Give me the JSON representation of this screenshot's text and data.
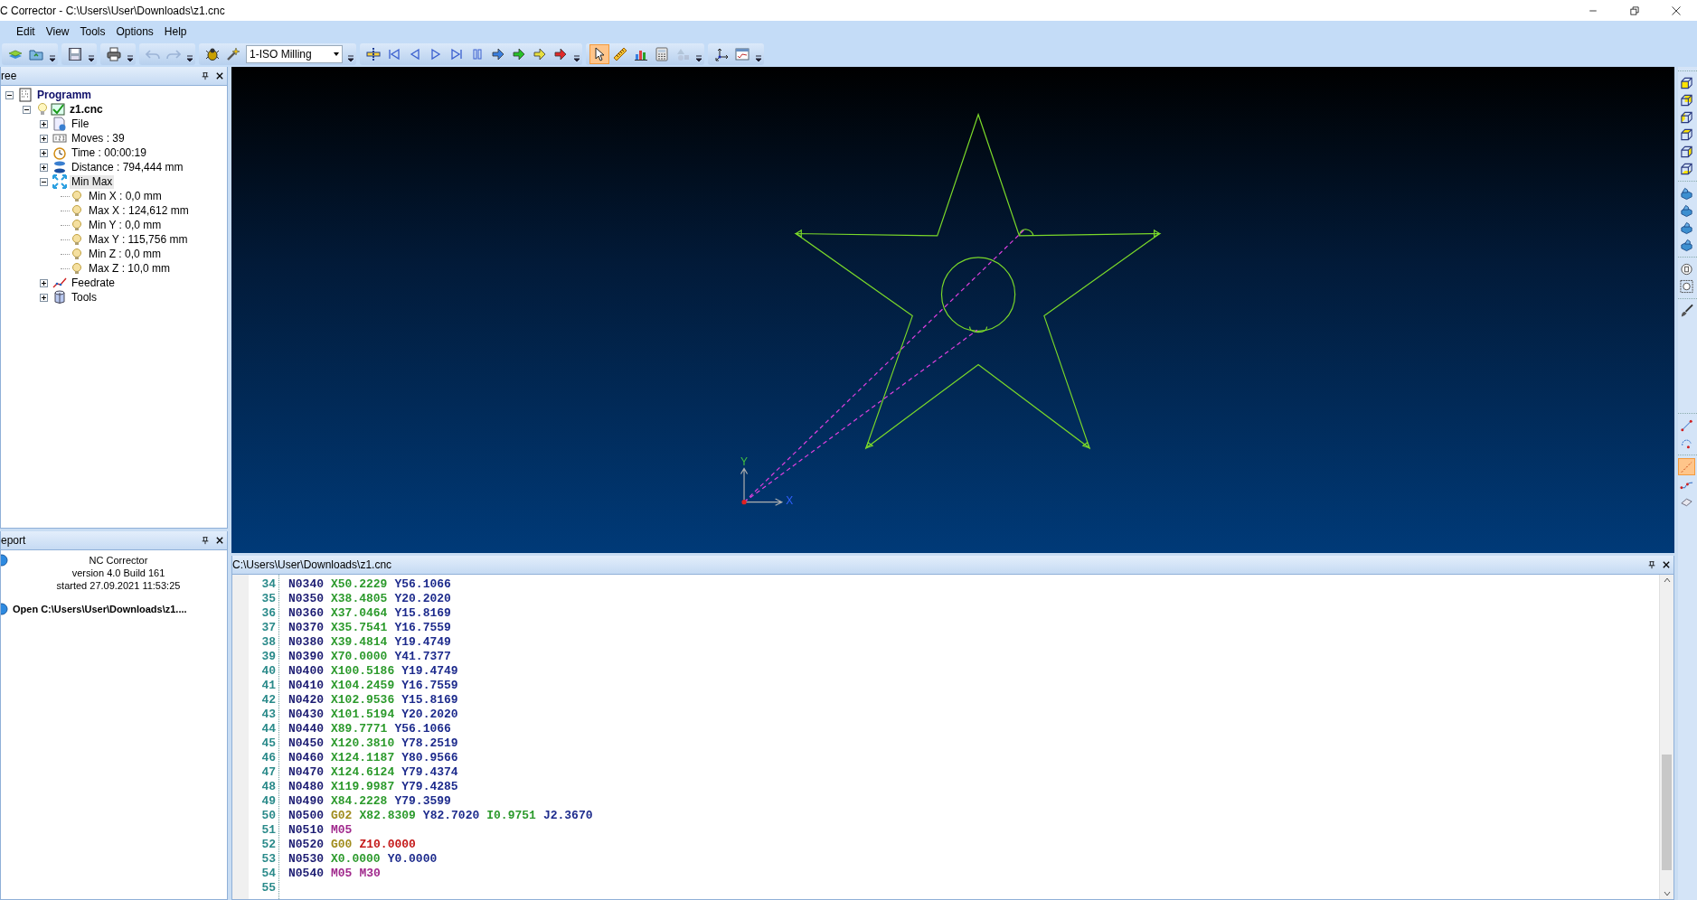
{
  "window": {
    "title": "C Corrector - C:\\Users\\User\\Downloads\\z1.cnc"
  },
  "menu": [
    "Edit",
    "View",
    "Tools",
    "Options",
    "Help"
  ],
  "toolbar": {
    "groups": [
      {
        "items": [
          {
            "kind": "layers",
            "disabled": false,
            "selected": false
          },
          {
            "kind": "open",
            "disabled": false,
            "selected": false
          }
        ]
      },
      {
        "items": [
          {
            "kind": "save",
            "disabled": false,
            "selected": false
          }
        ]
      },
      {
        "items": [
          {
            "kind": "print",
            "disabled": false,
            "selected": false
          }
        ]
      },
      {
        "items": [
          {
            "kind": "undo",
            "disabled": true,
            "selected": false
          },
          {
            "kind": "redo",
            "disabled": true,
            "selected": false
          }
        ]
      },
      {
        "items": [
          {
            "kind": "bug",
            "disabled": false,
            "selected": false
          },
          {
            "kind": "wand",
            "disabled": false,
            "selected": false
          },
          {
            "kind": "select",
            "value": "1-ISO Milling"
          }
        ]
      },
      {
        "items": [
          {
            "kind": "marker",
            "disabled": false,
            "selected": false
          },
          {
            "kind": "first",
            "disabled": false,
            "selected": false
          },
          {
            "kind": "prev",
            "disabled": false,
            "selected": false
          },
          {
            "kind": "next",
            "disabled": false,
            "selected": false
          },
          {
            "kind": "last",
            "disabled": false,
            "selected": false
          },
          {
            "kind": "pause",
            "disabled": false,
            "selected": false
          },
          {
            "kind": "step-blue",
            "disabled": false,
            "selected": false
          },
          {
            "kind": "step-green",
            "disabled": false,
            "selected": false
          },
          {
            "kind": "step-yellow",
            "disabled": false,
            "selected": false
          },
          {
            "kind": "step-red",
            "disabled": false,
            "selected": false
          }
        ]
      },
      {
        "items": [
          {
            "kind": "pointer",
            "disabled": false,
            "selected": true
          },
          {
            "kind": "ruler",
            "disabled": false,
            "selected": false
          },
          {
            "kind": "chart",
            "disabled": false,
            "selected": false
          },
          {
            "kind": "calculator",
            "disabled": false,
            "selected": false
          },
          {
            "kind": "shapes",
            "disabled": true,
            "selected": false
          }
        ]
      },
      {
        "items": [
          {
            "kind": "axes",
            "disabled": false,
            "selected": false
          },
          {
            "kind": "report",
            "disabled": false,
            "selected": false
          }
        ]
      }
    ]
  },
  "tree": {
    "title": "ree",
    "nodes": [
      {
        "label": "Programm",
        "kind": "program",
        "expanded": true,
        "selected": false,
        "children": [
          {
            "label": "z1.cnc",
            "kind": "program-file",
            "expanded": true,
            "selected": false,
            "children": [
              {
                "label": "File",
                "kind": "file-info",
                "expanded": false,
                "selected": false
              },
              {
                "label": "Moves : 39",
                "kind": "counter",
                "expanded": false,
                "selected": false
              },
              {
                "label": "Time : 00:00:19",
                "kind": "clock",
                "expanded": false,
                "selected": false
              },
              {
                "label": "Distance : 794,444 mm",
                "kind": "distance",
                "expanded": false,
                "selected": false
              },
              {
                "label": "Min Max",
                "kind": "minmax",
                "expanded": true,
                "selected": true,
                "children": [
                  {
                    "label": "Min X : 0,0 mm",
                    "kind": "point",
                    "selected": false
                  },
                  {
                    "label": "Max X : 124,612 mm",
                    "kind": "point",
                    "selected": false
                  },
                  {
                    "label": "Min Y : 0,0 mm",
                    "kind": "point",
                    "selected": false
                  },
                  {
                    "label": "Max Y : 115,756 mm",
                    "kind": "point",
                    "selected": false
                  },
                  {
                    "label": "Min Z : 0,0 mm",
                    "kind": "point",
                    "selected": false
                  },
                  {
                    "label": "Max Z : 10,0 mm",
                    "kind": "point",
                    "selected": false
                  }
                ]
              },
              {
                "label": "Feedrate",
                "kind": "feedrate",
                "expanded": false,
                "selected": false
              },
              {
                "label": "Tools",
                "kind": "tools",
                "expanded": false,
                "selected": false
              }
            ]
          }
        ]
      }
    ]
  },
  "report": {
    "title": "eport",
    "entries": [
      {
        "kind": "info",
        "lines": [
          "NC Corrector",
          "version 4.0 Build 161",
          "started 27.09.2021 11:53:25"
        ]
      },
      {
        "kind": "action",
        "lines": [
          "Open C:\\Users\\User\\Downloads\\z1...."
        ]
      }
    ]
  },
  "viewport": {
    "axis_labels": [
      {
        "text": "Y",
        "kind": "y"
      },
      {
        "text": "X",
        "kind": "x"
      }
    ]
  },
  "code": {
    "title": "C:\\Users\\User\\Downloads\\z1.cnc",
    "lines": [
      {
        "number": "34",
        "tokens": [
          {
            "text": "N0340",
            "kind": "n"
          },
          {
            "text": "X50.2229",
            "kind": "x"
          },
          {
            "text": "Y56.1066",
            "kind": "y"
          }
        ]
      },
      {
        "number": "35",
        "tokens": [
          {
            "text": "N0350",
            "kind": "n"
          },
          {
            "text": "X38.4805",
            "kind": "x"
          },
          {
            "text": "Y20.2020",
            "kind": "y"
          }
        ]
      },
      {
        "number": "36",
        "tokens": [
          {
            "text": "N0360",
            "kind": "n"
          },
          {
            "text": "X37.0464",
            "kind": "x"
          },
          {
            "text": "Y15.8169",
            "kind": "y"
          }
        ]
      },
      {
        "number": "37",
        "tokens": [
          {
            "text": "N0370",
            "kind": "n"
          },
          {
            "text": "X35.7541",
            "kind": "x"
          },
          {
            "text": "Y16.7559",
            "kind": "y"
          }
        ]
      },
      {
        "number": "38",
        "tokens": [
          {
            "text": "N0380",
            "kind": "n"
          },
          {
            "text": "X39.4814",
            "kind": "x"
          },
          {
            "text": "Y19.4749",
            "kind": "y"
          }
        ]
      },
      {
        "number": "39",
        "tokens": [
          {
            "text": "N0390",
            "kind": "n"
          },
          {
            "text": "X70.0000",
            "kind": "x"
          },
          {
            "text": "Y41.7377",
            "kind": "y"
          }
        ]
      },
      {
        "number": "40",
        "tokens": [
          {
            "text": "N0400",
            "kind": "n"
          },
          {
            "text": "X100.5186",
            "kind": "x"
          },
          {
            "text": "Y19.4749",
            "kind": "y"
          }
        ]
      },
      {
        "number": "41",
        "tokens": [
          {
            "text": "N0410",
            "kind": "n"
          },
          {
            "text": "X104.2459",
            "kind": "x"
          },
          {
            "text": "Y16.7559",
            "kind": "y"
          }
        ]
      },
      {
        "number": "42",
        "tokens": [
          {
            "text": "N0420",
            "kind": "n"
          },
          {
            "text": "X102.9536",
            "kind": "x"
          },
          {
            "text": "Y15.8169",
            "kind": "y"
          }
        ]
      },
      {
        "number": "43",
        "tokens": [
          {
            "text": "N0430",
            "kind": "n"
          },
          {
            "text": "X101.5194",
            "kind": "x"
          },
          {
            "text": "Y20.2020",
            "kind": "y"
          }
        ]
      },
      {
        "number": "44",
        "tokens": [
          {
            "text": "N0440",
            "kind": "n"
          },
          {
            "text": "X89.7771",
            "kind": "x"
          },
          {
            "text": "Y56.1066",
            "kind": "y"
          }
        ]
      },
      {
        "number": "45",
        "tokens": [
          {
            "text": "N0450",
            "kind": "n"
          },
          {
            "text": "X120.3810",
            "kind": "x"
          },
          {
            "text": "Y78.2519",
            "kind": "y"
          }
        ]
      },
      {
        "number": "46",
        "tokens": [
          {
            "text": "N0460",
            "kind": "n"
          },
          {
            "text": "X124.1187",
            "kind": "x"
          },
          {
            "text": "Y80.9566",
            "kind": "y"
          }
        ]
      },
      {
        "number": "47",
        "tokens": [
          {
            "text": "N0470",
            "kind": "n"
          },
          {
            "text": "X124.6124",
            "kind": "x"
          },
          {
            "text": "Y79.4374",
            "kind": "y"
          }
        ]
      },
      {
        "number": "48",
        "tokens": [
          {
            "text": "N0480",
            "kind": "n"
          },
          {
            "text": "X119.9987",
            "kind": "x"
          },
          {
            "text": "Y79.4285",
            "kind": "y"
          }
        ]
      },
      {
        "number": "49",
        "tokens": [
          {
            "text": "N0490",
            "kind": "n"
          },
          {
            "text": "X84.2228",
            "kind": "x"
          },
          {
            "text": "Y79.3599",
            "kind": "y"
          }
        ]
      },
      {
        "number": "50",
        "tokens": [
          {
            "text": "N0500",
            "kind": "n"
          },
          {
            "text": "G02",
            "kind": "g"
          },
          {
            "text": "X82.8309",
            "kind": "x"
          },
          {
            "text": "Y82.7020",
            "kind": "y"
          },
          {
            "text": "I0.9751",
            "kind": "i"
          },
          {
            "text": "J2.3670",
            "kind": "j"
          }
        ]
      },
      {
        "number": "51",
        "tokens": [
          {
            "text": "N0510",
            "kind": "n"
          },
          {
            "text": "M05",
            "kind": "m"
          }
        ]
      },
      {
        "number": "52",
        "tokens": [
          {
            "text": "N0520",
            "kind": "n"
          },
          {
            "text": "G00",
            "kind": "g"
          },
          {
            "text": "Z10.0000",
            "kind": "z"
          }
        ]
      },
      {
        "number": "53",
        "tokens": [
          {
            "text": "N0530",
            "kind": "n"
          },
          {
            "text": "X0.0000",
            "kind": "x"
          },
          {
            "text": "Y0.0000",
            "kind": "y"
          }
        ]
      },
      {
        "number": "54",
        "tokens": [
          {
            "text": "N0540",
            "kind": "n"
          },
          {
            "text": "M05",
            "kind": "m"
          },
          {
            "text": "M30",
            "kind": "m"
          }
        ]
      },
      {
        "number": "55"
      }
    ]
  },
  "side_toolbar": {
    "groups": [
      [
        {
          "kind": "view-front",
          "selected": false
        },
        {
          "kind": "view-back",
          "selected": false
        },
        {
          "kind": "view-left",
          "selected": false
        },
        {
          "kind": "view-top",
          "selected": false
        },
        {
          "kind": "view-right",
          "selected": false
        },
        {
          "kind": "view-bottom",
          "selected": false
        }
      ],
      [
        {
          "kind": "solid-a",
          "selected": false
        },
        {
          "kind": "solid-b",
          "selected": false
        },
        {
          "kind": "solid-c",
          "selected": false
        },
        {
          "kind": "solid-d",
          "selected": false
        }
      ],
      [
        {
          "kind": "zoom-page",
          "selected": false
        },
        {
          "kind": "zoom-box",
          "selected": false
        }
      ],
      [
        {
          "kind": "brush",
          "selected": false
        }
      ],
      [
        {
          "kind": "line",
          "selected": false
        },
        {
          "kind": "arc",
          "selected": false
        }
      ],
      [
        {
          "kind": "dashed",
          "selected": true
        },
        {
          "kind": "offset",
          "selected": false
        },
        {
          "kind": "eraser",
          "selected": false
        }
      ]
    ]
  }
}
